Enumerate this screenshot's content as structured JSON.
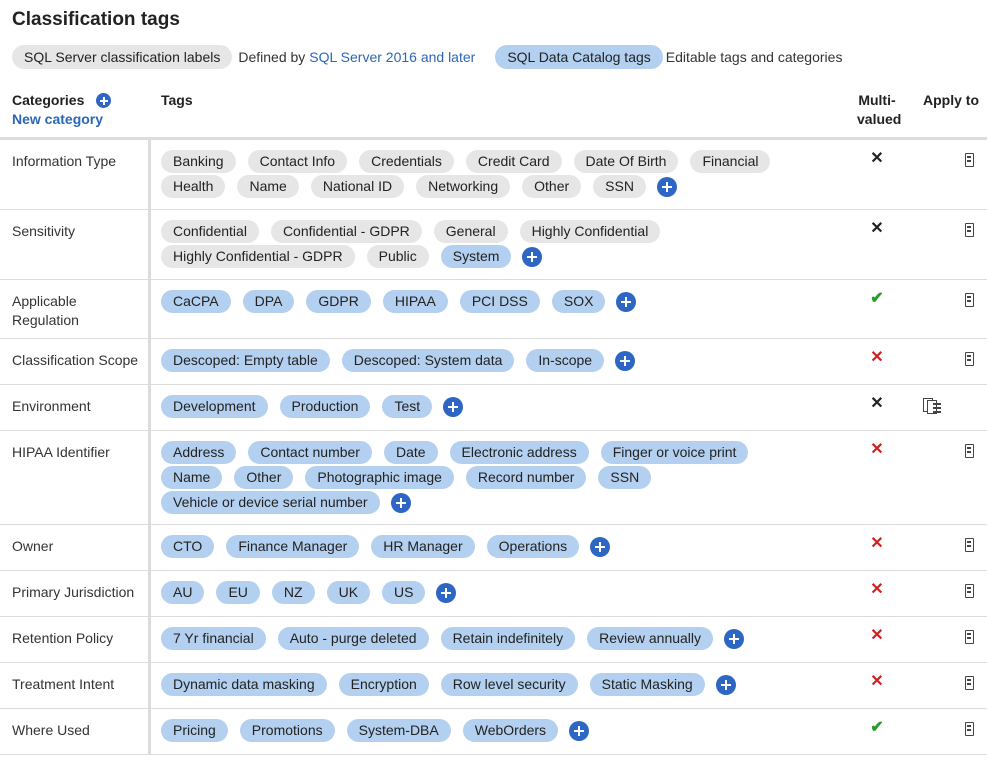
{
  "page": {
    "title": "Classification tags"
  },
  "legend": {
    "sql_server_label": "SQL Server classification labels",
    "defined_by": "Defined by",
    "defined_by_link": "SQL Server 2016 and later",
    "catalog_label": "SQL Data Catalog tags",
    "catalog_desc": "Editable tags and categories"
  },
  "headers": {
    "categories": "Categories",
    "new_category": "New category",
    "tags": "Tags",
    "multi_valued": "Multi-valued",
    "multi_line1": "Multi-",
    "multi_line2": "valued",
    "apply_to": "Apply to"
  },
  "colors": {
    "gray_tag": "#e6e6e6",
    "blue_tag": "#b3d0f0",
    "accent": "#2e66c4",
    "link": "#2b67b8",
    "red_x": "#d02020",
    "green_check": "#2a9a2a"
  },
  "rows": [
    {
      "category": "Information Type",
      "tags": [
        {
          "label": "Banking",
          "kind": "gray"
        },
        {
          "label": "Contact Info",
          "kind": "gray"
        },
        {
          "label": "Credentials",
          "kind": "gray"
        },
        {
          "label": "Credit Card",
          "kind": "gray"
        },
        {
          "label": "Date Of Birth",
          "kind": "gray"
        },
        {
          "label": "Financial",
          "kind": "gray"
        },
        {
          "label": "Health",
          "kind": "gray"
        },
        {
          "label": "Name",
          "kind": "gray"
        },
        {
          "label": "National ID",
          "kind": "gray"
        },
        {
          "label": "Networking",
          "kind": "gray"
        },
        {
          "label": "Other",
          "kind": "gray"
        },
        {
          "label": "SSN",
          "kind": "gray"
        }
      ],
      "multi_valued": "x-black",
      "apply_to": "column-icon"
    },
    {
      "category": "Sensitivity",
      "tags": [
        {
          "label": "Confidential",
          "kind": "gray"
        },
        {
          "label": "Confidential - GDPR",
          "kind": "gray"
        },
        {
          "label": "General",
          "kind": "gray"
        },
        {
          "label": "Highly Confidential",
          "kind": "gray"
        },
        {
          "label": "Highly Confidential - GDPR",
          "kind": "gray"
        },
        {
          "label": "Public",
          "kind": "gray"
        },
        {
          "label": "System",
          "kind": "blue"
        }
      ],
      "multi_valued": "x-black",
      "apply_to": "column-icon"
    },
    {
      "category": "Applicable Regulation",
      "tags": [
        {
          "label": "CaCPA",
          "kind": "blue"
        },
        {
          "label": "DPA",
          "kind": "blue"
        },
        {
          "label": "GDPR",
          "kind": "blue"
        },
        {
          "label": "HIPAA",
          "kind": "blue"
        },
        {
          "label": "PCI DSS",
          "kind": "blue"
        },
        {
          "label": "SOX",
          "kind": "blue"
        }
      ],
      "multi_valued": "check",
      "apply_to": "column-icon"
    },
    {
      "category": "Classification Scope",
      "tags": [
        {
          "label": "Descoped: Empty table",
          "kind": "blue"
        },
        {
          "label": "Descoped: System data",
          "kind": "blue"
        },
        {
          "label": "In-scope",
          "kind": "blue"
        }
      ],
      "multi_valued": "x-red",
      "apply_to": "column-icon"
    },
    {
      "category": "Environment",
      "tags": [
        {
          "label": "Development",
          "kind": "blue"
        },
        {
          "label": "Production",
          "kind": "blue"
        },
        {
          "label": "Test",
          "kind": "blue"
        }
      ],
      "multi_valued": "x-black",
      "apply_to": "instance-icon"
    },
    {
      "category": "HIPAA Identifier",
      "tags": [
        {
          "label": "Address",
          "kind": "blue"
        },
        {
          "label": "Contact number",
          "kind": "blue"
        },
        {
          "label": "Date",
          "kind": "blue"
        },
        {
          "label": "Electronic address",
          "kind": "blue"
        },
        {
          "label": "Finger or voice print",
          "kind": "blue"
        },
        {
          "label": "Name",
          "kind": "blue"
        },
        {
          "label": "Other",
          "kind": "blue"
        },
        {
          "label": "Photographic image",
          "kind": "blue"
        },
        {
          "label": "Record number",
          "kind": "blue"
        },
        {
          "label": "SSN",
          "kind": "blue"
        },
        {
          "label": "Vehicle or device serial number",
          "kind": "blue"
        }
      ],
      "multi_valued": "x-red",
      "apply_to": "column-icon"
    },
    {
      "category": "Owner",
      "tags": [
        {
          "label": "CTO",
          "kind": "blue"
        },
        {
          "label": "Finance Manager",
          "kind": "blue"
        },
        {
          "label": "HR Manager",
          "kind": "blue"
        },
        {
          "label": "Operations",
          "kind": "blue"
        }
      ],
      "multi_valued": "x-red",
      "apply_to": "column-icon"
    },
    {
      "category": "Primary Jurisdiction",
      "tags": [
        {
          "label": "AU",
          "kind": "blue"
        },
        {
          "label": "EU",
          "kind": "blue"
        },
        {
          "label": "NZ",
          "kind": "blue"
        },
        {
          "label": "UK",
          "kind": "blue"
        },
        {
          "label": "US",
          "kind": "blue"
        }
      ],
      "multi_valued": "x-red",
      "apply_to": "column-icon"
    },
    {
      "category": "Retention Policy",
      "tags": [
        {
          "label": "7 Yr financial",
          "kind": "blue"
        },
        {
          "label": "Auto - purge deleted",
          "kind": "blue"
        },
        {
          "label": "Retain indefinitely",
          "kind": "blue"
        },
        {
          "label": "Review annually",
          "kind": "blue"
        }
      ],
      "multi_valued": "x-red",
      "apply_to": "column-icon"
    },
    {
      "category": "Treatment Intent",
      "tags": [
        {
          "label": "Dynamic data masking",
          "kind": "blue"
        },
        {
          "label": "Encryption",
          "kind": "blue"
        },
        {
          "label": "Row level security",
          "kind": "blue"
        },
        {
          "label": "Static Masking",
          "kind": "blue"
        }
      ],
      "multi_valued": "x-red",
      "apply_to": "column-icon"
    },
    {
      "category": "Where Used",
      "tags": [
        {
          "label": "Pricing",
          "kind": "blue"
        },
        {
          "label": "Promotions",
          "kind": "blue"
        },
        {
          "label": "System-DBA",
          "kind": "blue"
        },
        {
          "label": "WebOrders",
          "kind": "blue"
        }
      ],
      "multi_valued": "check",
      "apply_to": "column-icon"
    }
  ]
}
